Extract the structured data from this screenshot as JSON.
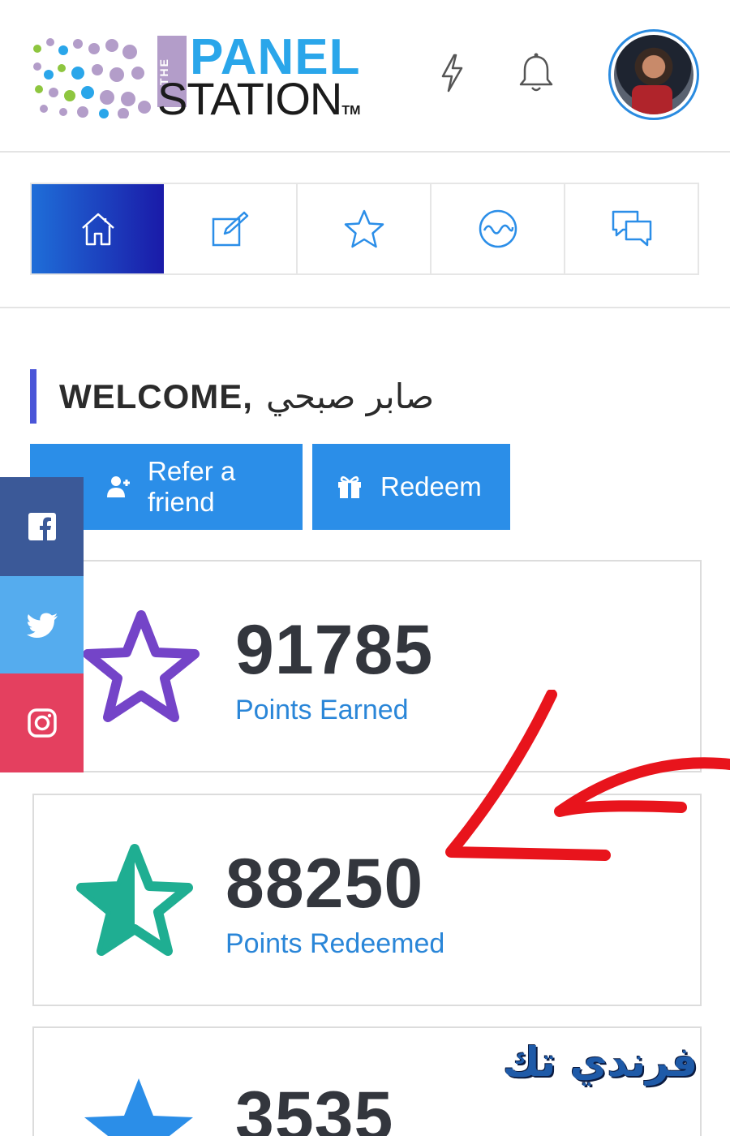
{
  "header": {
    "logo": {
      "the": "THE",
      "panel": "PANEL",
      "station": "STATION",
      "tm": "TM"
    },
    "icons": [
      "lightning-icon",
      "bell-icon"
    ]
  },
  "nav": {
    "tabs": [
      {
        "icon": "home-icon",
        "active": true
      },
      {
        "icon": "edit-icon",
        "active": false
      },
      {
        "icon": "star-icon",
        "active": false
      },
      {
        "icon": "wave-icon",
        "active": false
      },
      {
        "icon": "chat-icon",
        "active": false
      }
    ]
  },
  "welcome": {
    "label": "WELCOME,",
    "name": "صابر صبحي"
  },
  "actions": {
    "refer_label": "Refer a friend",
    "redeem_label": "Redeem"
  },
  "stats": [
    {
      "value": "91785",
      "label": "Points Earned",
      "icon": "star-outline-icon",
      "color": "#7444c8"
    },
    {
      "value": "88250",
      "label": "Points Redeemed",
      "icon": "star-half-icon",
      "color": "#1fae92"
    },
    {
      "value": "3535",
      "label": "",
      "icon": "star-filled-icon",
      "color": "#2b8ee8"
    }
  ],
  "social": [
    "facebook-icon",
    "twitter-icon",
    "instagram-icon"
  ],
  "watermark": "فرندي تك",
  "colors": {
    "primary": "#2b8ee8",
    "accent": "#4a55d8",
    "annotation": "#e8141c"
  }
}
